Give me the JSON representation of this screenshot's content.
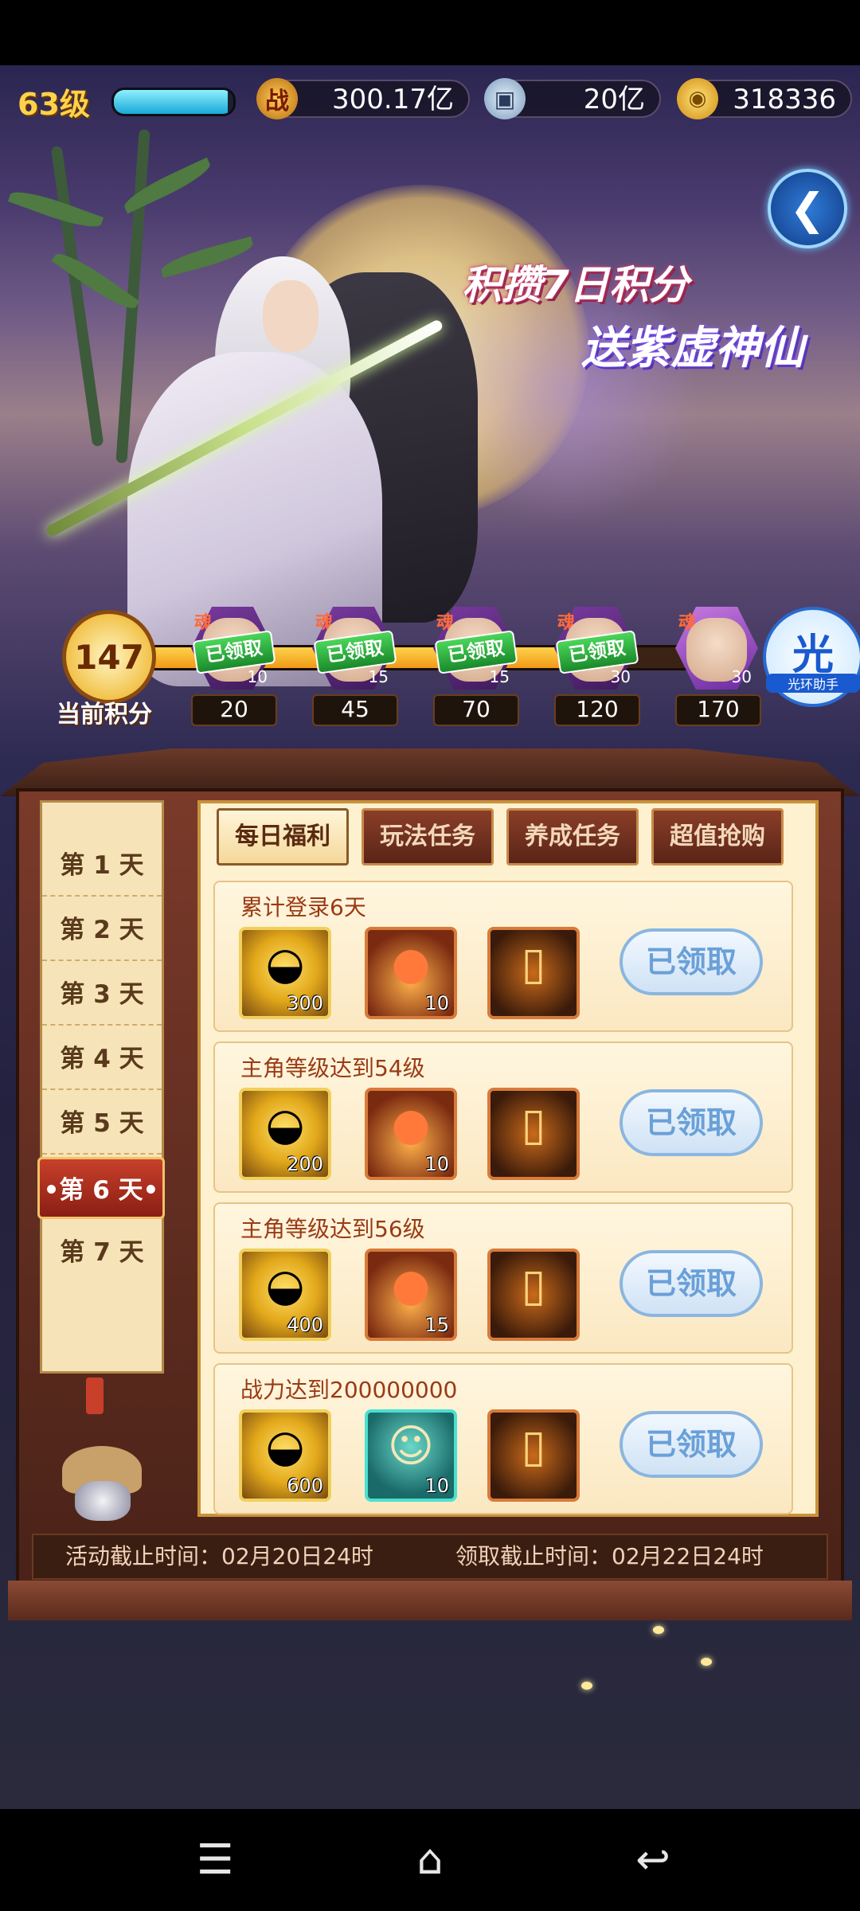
{
  "topbar": {
    "level": "63级",
    "exp_fraction": 0.95,
    "battle_icon": "战",
    "battle_power": "300.17亿",
    "coin_value": "20亿",
    "ingot_value": "318336"
  },
  "banner": {
    "line1": "积攒7日积分",
    "line2": "送紫虚神仙"
  },
  "progress": {
    "current_score": "147",
    "current_label": "当前积分",
    "fill_fraction": 0.86,
    "nodes": [
      {
        "soul": "魂",
        "status": "已领取",
        "count": "10",
        "score": "20"
      },
      {
        "soul": "魂",
        "status": "已领取",
        "count": "15",
        "score": "45"
      },
      {
        "soul": "魂",
        "status": "已领取",
        "count": "15",
        "score": "70"
      },
      {
        "soul": "魂",
        "status": "已领取",
        "count": "30",
        "score": "120"
      },
      {
        "soul": "魂",
        "status": "",
        "count": "30",
        "score": "170"
      }
    ]
  },
  "assistant": {
    "main": "光",
    "sub": "光环助手"
  },
  "sidebar": {
    "days": [
      "第 1 天",
      "第 2 天",
      "第 3 天",
      "第 4 天",
      "第 5 天",
      "•第 6 天•",
      "第 7 天"
    ],
    "active_index": 5
  },
  "tabs": [
    "每日福利",
    "玩法任务",
    "养成任务",
    "超值抢购"
  ],
  "tasks": [
    {
      "title": "累计登录6天",
      "items": [
        {
          "icon": "gold-ingot-icon",
          "count": "300"
        },
        {
          "icon": "orb-icon",
          "count": "10"
        },
        {
          "icon": "ticket-icon",
          "count": ""
        }
      ],
      "button": "已领取"
    },
    {
      "title": "主角等级达到54级",
      "items": [
        {
          "icon": "gold-ingot-icon",
          "count": "200"
        },
        {
          "icon": "orb-icon",
          "count": "10"
        },
        {
          "icon": "ticket-icon",
          "count": ""
        }
      ],
      "button": "已领取"
    },
    {
      "title": "主角等级达到56级",
      "items": [
        {
          "icon": "gold-ingot-icon",
          "count": "400"
        },
        {
          "icon": "orb-icon",
          "count": "15"
        },
        {
          "icon": "ticket-icon",
          "count": ""
        }
      ],
      "button": "已领取"
    },
    {
      "title": "战力达到200000000",
      "items": [
        {
          "icon": "gold-ingot-icon",
          "count": "600"
        },
        {
          "icon": "hero-chest-icon",
          "count": "10"
        },
        {
          "icon": "ticket-icon",
          "count": ""
        }
      ],
      "button": "已领取"
    }
  ],
  "footer": {
    "activity_end": "活动截止时间：02月20日24时",
    "claim_end": "领取截止时间：02月22日24时"
  },
  "colors": {
    "accent_gold": "#ffd24a",
    "claimed_green": "#1a8a2a",
    "button_blue": "#6aa0d8"
  }
}
